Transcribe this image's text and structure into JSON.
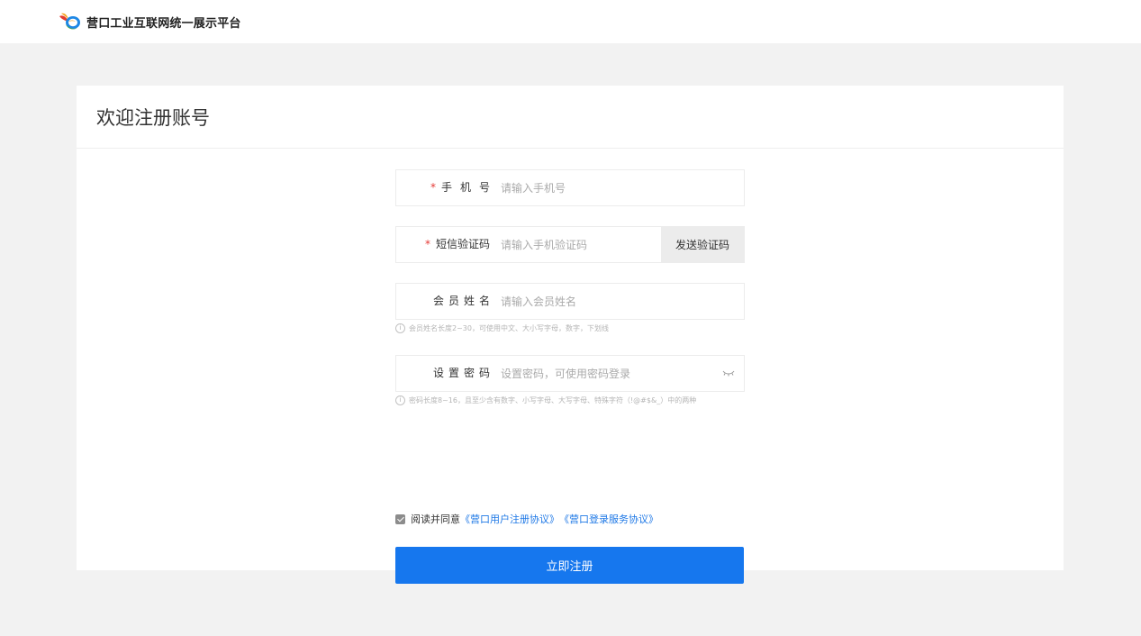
{
  "header": {
    "site_name": "营口工业互联网统一展示平台"
  },
  "card": {
    "title": "欢迎注册账号"
  },
  "form": {
    "phone": {
      "label": "手机号",
      "required_mark": "*",
      "placeholder": "请输入手机号",
      "value": ""
    },
    "sms_code": {
      "label": "短信验证码",
      "required_mark": "*",
      "placeholder": "请输入手机验证码",
      "value": "",
      "send_button": "发送验证码"
    },
    "member_name": {
      "label": "会员姓名",
      "placeholder": "请输入会员姓名",
      "value": "",
      "hint": "会员姓名长度2~30，可使用中文、大小写字母，数字，下划线"
    },
    "password": {
      "label": "设置密码",
      "placeholder": "设置密码，可使用密码登录",
      "value": "",
      "hint": "密码长度8~16，且至少含有数字、小写字母、大写字母、特殊字符（!@#$&_）中的两种"
    },
    "agreement": {
      "checked": true,
      "prefix": "阅读并同意",
      "link_user": "《营口用户注册协议》",
      "link_service": "《营口登录服务协议》"
    },
    "submit_label": "立即注册"
  },
  "colors": {
    "primary": "#1677ee",
    "link": "#1e78e6",
    "required": "#e53935",
    "page_bg": "#f2f2f2"
  },
  "icons": {
    "logo": "brand-logo-icon",
    "password_toggle": "eye-closed-icon",
    "hint": "info-circle-icon",
    "checkbox": "checkbox-checked-icon"
  }
}
